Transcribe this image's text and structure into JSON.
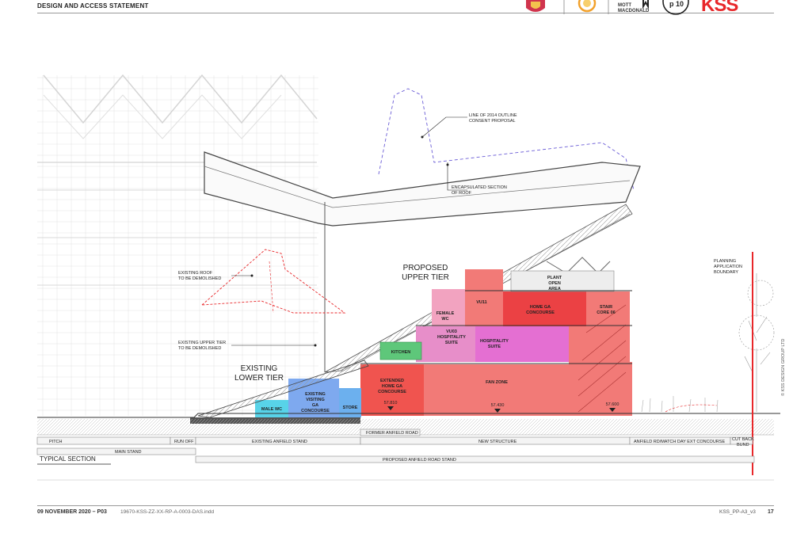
{
  "header": {
    "title": "DESIGN AND ACCESS STATEMENT",
    "logo_text_1": "MOTT",
    "logo_text_2": "MACDONALD",
    "kss": "KSS",
    "p10": "p 10"
  },
  "annotations": {
    "outline_1": "LINE OF 2014 OUTLINE",
    "outline_2": "CONSENT PROPOSAL",
    "roof_1": "ENCAPSULATED SECTION",
    "roof_2": "OF ROOF",
    "demol_roof_1": "EXISTING ROOF",
    "demol_roof_2": "TO BE DEMOLISHED",
    "demol_tier_1": "EXISTING UPPER TIER",
    "demol_tier_2": "TO BE DEMOLISHED",
    "boundary_1": "PLANNING",
    "boundary_2": "APPLICATION",
    "boundary_3": "BOUNDARY",
    "upper_1": "PROPOSED",
    "upper_2": "UPPER TIER",
    "lower_1": "EXISTING",
    "lower_2": "LOWER TIER"
  },
  "rooms": {
    "male_wc": "MALE WC",
    "visiting_1": "EXISTING",
    "visiting_2": "VISITING",
    "visiting_3": "GA",
    "visiting_4": "CONCOURSE",
    "store": "STORE",
    "kitchen": "KITCHEN",
    "ext_1": "EXTENDED",
    "ext_2": "HOME GA",
    "ext_3": "CONCOURSE",
    "fan_zone": "FAN ZONE",
    "vu03_1": "VU03",
    "vu03_2": "HOSPITALITY",
    "vu03_3": "SUITE",
    "hosp_1": "HOSPITALITY",
    "hosp_2": "SUITE",
    "female_1": "FEMALE",
    "female_2": "WC",
    "vu11": "VU11",
    "home_1": "HOME GA",
    "home_2": "CONCOURSE",
    "stair_1": "STAIR",
    "stair_2": "CORE 06",
    "plant_1": "PLANT",
    "plant_2": "OPEN",
    "plant_3": "AREA"
  },
  "levels": {
    "l1": "57.810",
    "l2": "57.430",
    "l3": "57.600"
  },
  "zones_row1": {
    "pitch": "PITCH",
    "runoff": "RUN OFF",
    "existing_anfield": "EXISTING ANFIELD STAND",
    "former_road": "FORMER ANFIELD ROAD",
    "new_structure": "NEW STRUCTURE",
    "anfield_rd": "ANFIELD RD/MATCH DAY EXT CONCOURSE",
    "cut_back_1": "CUT BACK",
    "cut_back_2": "BUND"
  },
  "zones_row2": {
    "main_stand": "MAIN STAND",
    "proposed": "PROPOSED ANFIELD ROAD STAND"
  },
  "section_title": "TYPICAL SECTION",
  "footer": {
    "date": "09 NOVEMBER 2020 – P03",
    "file": "19670-KSS-ZZ-XX-RP-A-0003-DAS.indd",
    "ref": "KSS_PP-A3_v3",
    "page": "17",
    "credit": "© KSS DESIGN GROUP LTD"
  },
  "colors": {
    "red": "#e8272a",
    "coral": "#f27a77",
    "pink": "#f2a3c0",
    "magenta": "#e46fd2",
    "blue": "#7ea9ef",
    "cyan": "#58d3e8",
    "green": "#5ec77a"
  }
}
